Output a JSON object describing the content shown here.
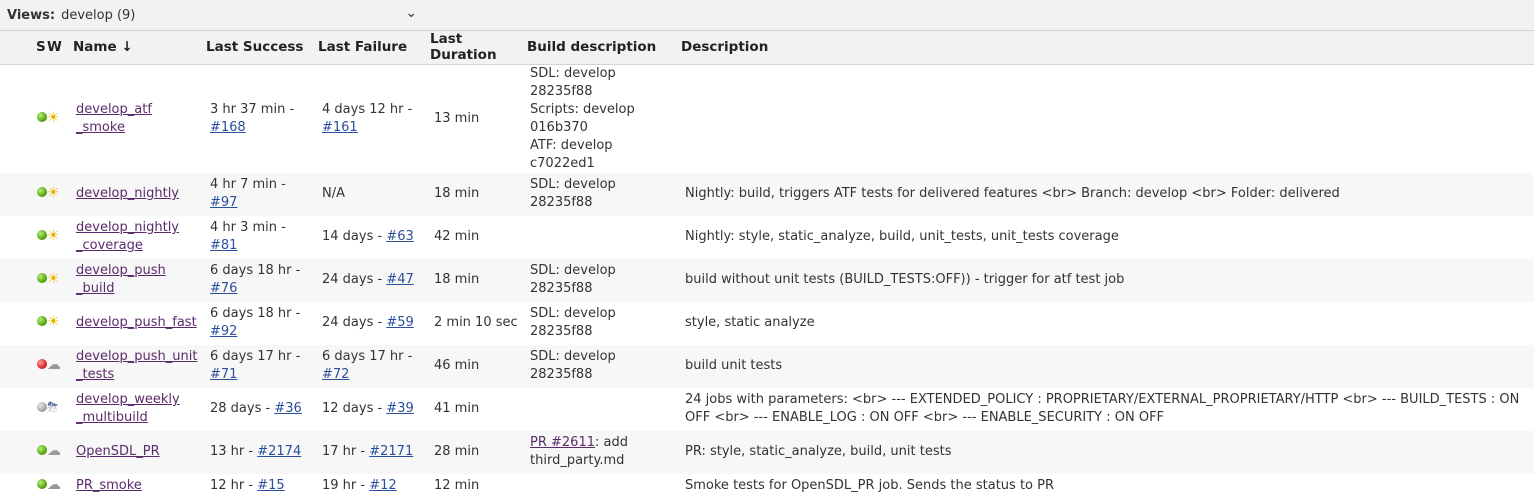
{
  "views": {
    "label": "Views:",
    "selected": "develop (9)"
  },
  "columns": [
    "S",
    "W",
    "Name ↓",
    "Last Success",
    "Last Failure",
    "Last Duration",
    "Build description",
    "Description"
  ],
  "jobs": [
    {
      "status": "blue",
      "weather": "sun",
      "name_lines": [
        "develop_atf",
        "_smoke"
      ],
      "success_text": "3 hr 37 min -",
      "success_link": "#168",
      "failure_text": "4 days 12 hr -",
      "failure_link": "#161",
      "duration": "13 min",
      "build_desc_lines": [
        "SDL: develop 28235f88",
        "Scripts: develop",
        "016b370",
        "ATF: develop c7022ed1"
      ],
      "desc_lines": [
        ""
      ]
    },
    {
      "status": "blue",
      "weather": "sun",
      "name_lines": [
        "develop_nightly"
      ],
      "success_text": "4 hr 7 min -",
      "success_link": "#97",
      "failure_text": "N/A",
      "failure_link": "",
      "duration": "18 min",
      "build_desc_lines": [
        "SDL: develop 28235f88"
      ],
      "desc_lines": [
        "Nightly: build, triggers ATF tests for delivered features <br> Branch: develop <br> Folder: delivered"
      ]
    },
    {
      "status": "blue",
      "weather": "sun",
      "name_lines": [
        "develop_nightly",
        "_coverage"
      ],
      "success_text": "4 hr 3 min -",
      "success_link": "#81",
      "failure_text": "14 days -",
      "failure_link": "#63",
      "duration": "42 min",
      "build_desc_lines": [
        ""
      ],
      "desc_lines": [
        "Nightly: style, static_analyze, build, unit_tests, unit_tests coverage"
      ]
    },
    {
      "status": "blue",
      "weather": "sun",
      "name_lines": [
        "develop_push",
        "_build"
      ],
      "success_text": "6 days 18 hr -",
      "success_link": "#76",
      "failure_text": "24 days -",
      "failure_link": "#47",
      "duration": "18 min",
      "build_desc_lines": [
        "SDL: develop 28235f88"
      ],
      "desc_lines": [
        "build without unit tests (BUILD_TESTS:OFF)) - trigger for atf test job"
      ]
    },
    {
      "status": "blue",
      "weather": "sun",
      "name_lines": [
        "develop_push_fast"
      ],
      "success_text": "6 days 18 hr -",
      "success_link": "#92",
      "failure_text": "24 days -",
      "failure_link": "#59",
      "duration": "2 min 10 sec",
      "build_desc_lines": [
        "SDL: develop 28235f88"
      ],
      "desc_lines": [
        "style, static analyze"
      ]
    },
    {
      "status": "red",
      "weather": "cloud",
      "name_lines": [
        "develop_push_unit",
        "_tests"
      ],
      "success_text": "6 days 17 hr -",
      "success_link": "#71",
      "failure_text": "6 days 17 hr -",
      "failure_link": "#72",
      "duration": "46 min",
      "build_desc_lines": [
        "SDL: develop 28235f88"
      ],
      "desc_lines": [
        "build unit tests"
      ]
    },
    {
      "status": "grey",
      "weather": "storm",
      "name_lines": [
        "develop_weekly",
        "_multibuild"
      ],
      "success_text": "28 days -",
      "success_link": "#36",
      "failure_text": "12 days -",
      "failure_link": "#39",
      "duration": "41 min",
      "build_desc_lines": [
        ""
      ],
      "desc_lines": [
        "24 jobs with parameters: <br> --- EXTENDED_POLICY : PROPRIETARY/EXTERNAL_PROPRIETARY/HTTP <br> --- BUILD_TESTS : ON",
        "OFF <br> --- ENABLE_LOG : ON OFF <br> --- ENABLE_SECURITY : ON OFF"
      ]
    },
    {
      "status": "blue",
      "weather": "cloud",
      "name_lines": [
        "OpenSDL_PR"
      ],
      "success_text": "13 hr -",
      "success_link": "#2174",
      "failure_text": "17 hr -",
      "failure_link": "#2171",
      "duration": "28 min",
      "build_desc_link": "PR #2611",
      "build_desc_lines": [
        ": add",
        "third_party.md"
      ],
      "desc_lines": [
        "PR: style, static_analyze, build, unit tests"
      ]
    },
    {
      "status": "blue",
      "weather": "cloud",
      "name_lines": [
        "PR_smoke"
      ],
      "success_text": "12 hr -",
      "success_link": "#15",
      "failure_text": "19 hr -",
      "failure_link": "#12",
      "duration": "12 min",
      "build_desc_lines": [
        ""
      ],
      "desc_lines": [
        "Smoke tests for OpenSDL_PR job. Sends the status to PR"
      ]
    }
  ]
}
